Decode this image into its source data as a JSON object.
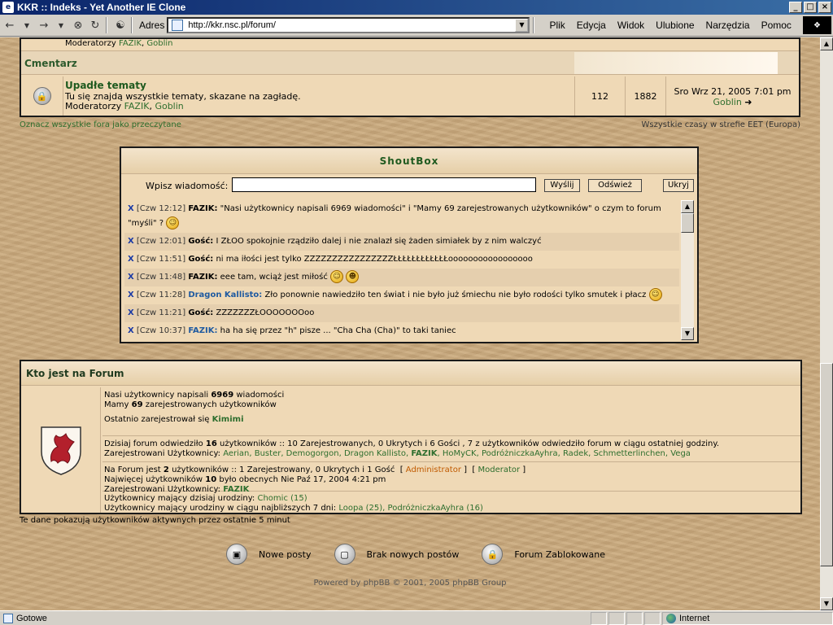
{
  "window": {
    "title": "KKR :: Indeks - Yet Another IE Clone",
    "buttons": [
      "_",
      "□",
      "×"
    ]
  },
  "toolbar": {
    "address_label": "Adres",
    "url": "http://kkr.nsc.pl/forum/",
    "menu": [
      "Plik",
      "Edycja",
      "Widok",
      "Ulubione",
      "Narzędzia",
      "Pomoc"
    ]
  },
  "forum": {
    "prev_moderators_label": "Moderatorzy",
    "prev_moderators": [
      "FAZIK",
      "Goblin"
    ],
    "category": "Cmentarz",
    "row": {
      "name": "Upadłe tematy",
      "description": "Tu się znajdą wszystkie tematy, skazane na zagładę.",
      "moderators_label": "Moderatorzy",
      "moderators": [
        "FAZIK",
        "Goblin"
      ],
      "topics": "112",
      "posts": "1882",
      "last_post_date": "Sro Wrz 21, 2005 7:01 pm",
      "last_post_user": "Goblin"
    },
    "mark_read": "Oznacz wszystkie fora jako przeczytane",
    "timezone": "Wszystkie czasy w strefie EET (Europa)"
  },
  "shoutbox": {
    "title": "ShoutBox",
    "input_label": "Wpisz wiadomość:",
    "send": "Wyślij",
    "refresh": "Odśwież",
    "hide": "Ukryj",
    "messages": [
      {
        "time": "[Czw 12:12]",
        "user": "FAZIK:",
        "text": "\"Nasi użytkownicy napisali 6969 wiadomości\" i \"Mamy 69 zarejestrowanych użytkowników\" o czym to forum \"myśli\" ?"
      },
      {
        "time": "[Czw 12:01]",
        "user": "Gość:",
        "text": "I ZŁOO spokojnie rządziło dalej i nie znalazł się żaden simiałek by z nim walczyć"
      },
      {
        "time": "[Czw 11:51]",
        "user": "Gość:",
        "text": "ni ma iłości jest tylko ZZZZZZZZZZZZZZZZŁŁŁŁŁŁŁŁŁŁŁŁooooooooooooooooo"
      },
      {
        "time": "[Czw 11:48]",
        "user": "FAZIK:",
        "text": "eee tam, wciąż jest miłość"
      },
      {
        "time": "[Czw 11:28]",
        "user": "Dragon Kallisto:",
        "text": "Zło ponownie nawiedziło ten świat i nie było już śmiechu nie było rodości tylko smutek i płacz"
      },
      {
        "time": "[Czw 11:21]",
        "user": "Gość:",
        "text": "ZZZZZZZŁOOOOOOOoo"
      },
      {
        "time": "[Czw 10:37]",
        "user": "FAZIK:",
        "text": "ha ha się przez \"h\" pisze ... \"Cha Cha (Cha)\" to taki taniec"
      }
    ]
  },
  "who": {
    "title": "Kto jest na Forum",
    "posts_line_pre": "Nasi użytkownicy napisali",
    "posts_count": "6969",
    "posts_line_post": "wiadomości",
    "users_line_pre": "Mamy",
    "users_count": "69",
    "users_line_post": "zarejestrowanych użytkowników",
    "newest_label": "Ostatnio zarejestrował się",
    "newest_user": "Kimimi",
    "today_pre": "Dzisiaj forum odwiedziło",
    "today_count": "16",
    "today_post": "użytkowników :: 10 Zarejestrowanych, 0 Ukrytych i 6 Gości , 7 z użytkowników odwiedziło forum w ciągu ostatniej godziny.",
    "today_registered_label": "Zarejestrowani Użytkownicy:",
    "today_users": "Aerian, Buster, Demogorgon, Dragon Kallisto,",
    "today_users_bold": "FAZIK",
    "today_users_rest": ", HoMyCK, PodróżniczkaAyhra, Radek, Schmetterlinchen, Vega",
    "now_pre": "Na Forum jest",
    "now_count": "2",
    "now_post": "użytkowników :: 1 Zarejestrowany, 0 Ukrytych i 1 Gość",
    "admin_label": "Administrator",
    "moderator_label": "Moderator",
    "most_pre": "Najwięcej użytkowników",
    "most_count": "10",
    "most_post": "było obecnych Nie Paź 17, 2004 4:21 pm",
    "now_registered_label": "Zarejestrowani Użytkownicy:",
    "now_user": "FAZIK",
    "bday_today_label": "Użytkownicy mający dzisiaj urodziny:",
    "bday_today": "Chomic (15)",
    "bday_week_label": "Użytkownicy mający urodziny w ciągu najbliższych 7 dni:",
    "bday_week": "Loopa (25), PodróżniczkaAyhra (16)",
    "footnote": "Te dane pokazują użytkowników aktywnych przez ostatnie 5 minut"
  },
  "legend": {
    "new_posts": "Nowe posty",
    "no_new_posts": "Brak nowych postów",
    "locked": "Forum Zablokowane"
  },
  "powered": "Powered by phpBB © 2001, 2005 phpBB Group",
  "status": {
    "left": "Gotowe",
    "zone": "Internet"
  }
}
